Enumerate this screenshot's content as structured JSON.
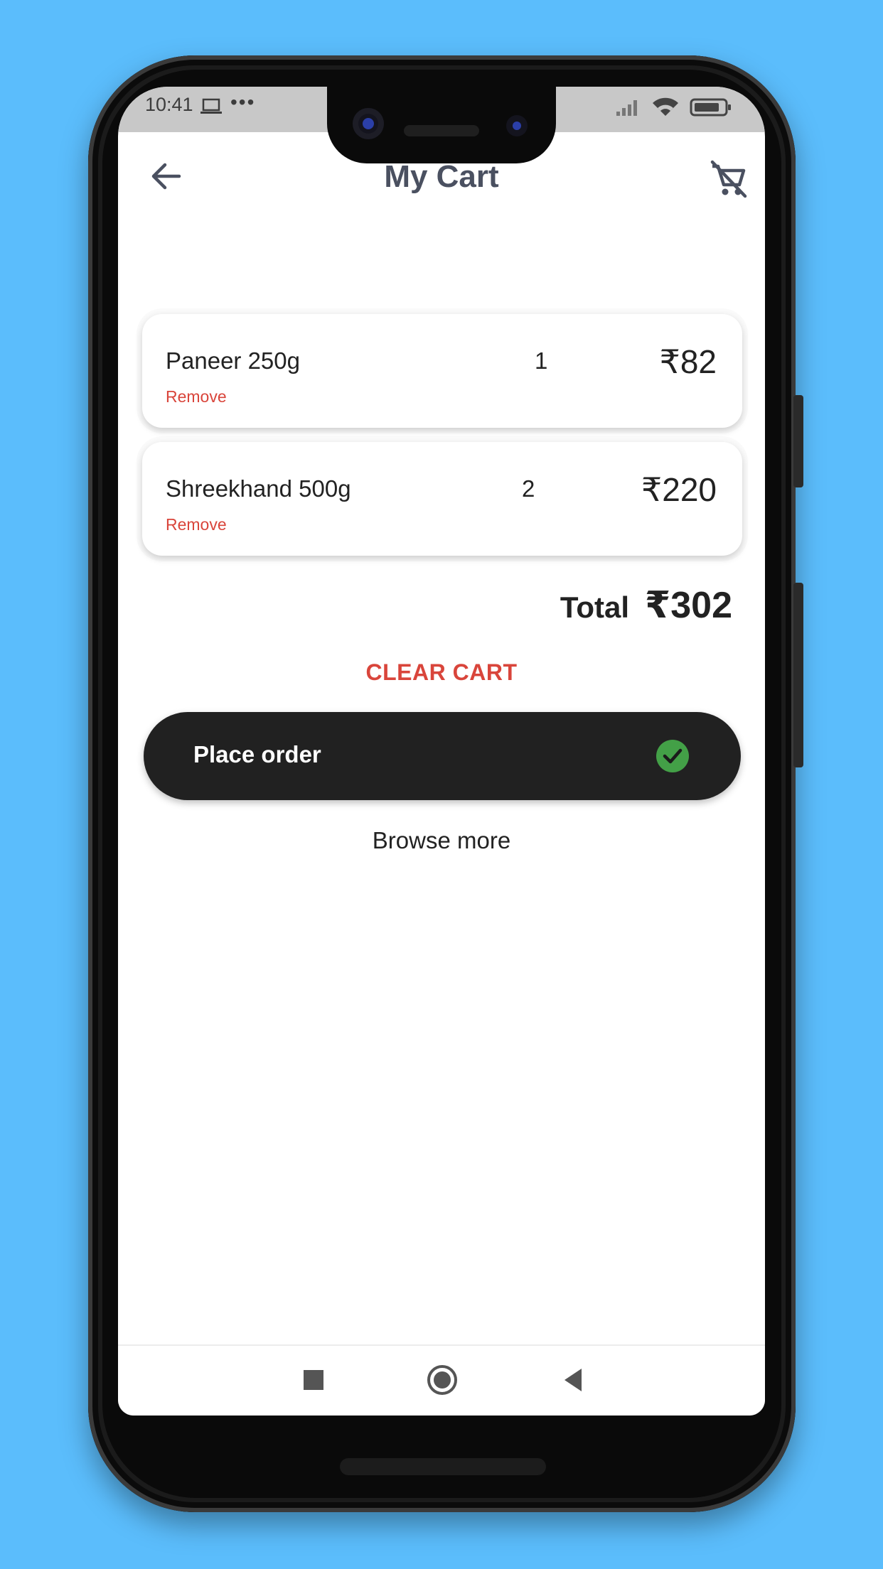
{
  "status_bar": {
    "time": "10:41",
    "dots": "•••",
    "icons": [
      "laptop-icon",
      "signal-icon",
      "wifi-icon",
      "battery-icon"
    ]
  },
  "header": {
    "title": "My Cart",
    "back_icon": "arrow-left-icon",
    "clear_icon": "remove-shopping-cart-icon"
  },
  "cart": {
    "items": [
      {
        "name": "Paneer 250g",
        "quantity": "1",
        "price": "₹82",
        "remove_label": "Remove"
      },
      {
        "name": "Shreekhand 500g",
        "quantity": "2",
        "price": "₹220",
        "remove_label": "Remove"
      }
    ],
    "total_label": "Total",
    "total_value": "₹302"
  },
  "actions": {
    "clear_cart": "CLEAR CART",
    "place_order": "Place order",
    "browse_more": "Browse more"
  },
  "nav": {
    "icons": [
      "recents-square-icon",
      "home-circle-icon",
      "back-triangle-icon"
    ]
  },
  "colors": {
    "background": "#5bbdfc",
    "accent_red": "#d9453b",
    "dark_button": "#212121",
    "check_green": "#43a047",
    "title_gray": "#4a5060"
  }
}
